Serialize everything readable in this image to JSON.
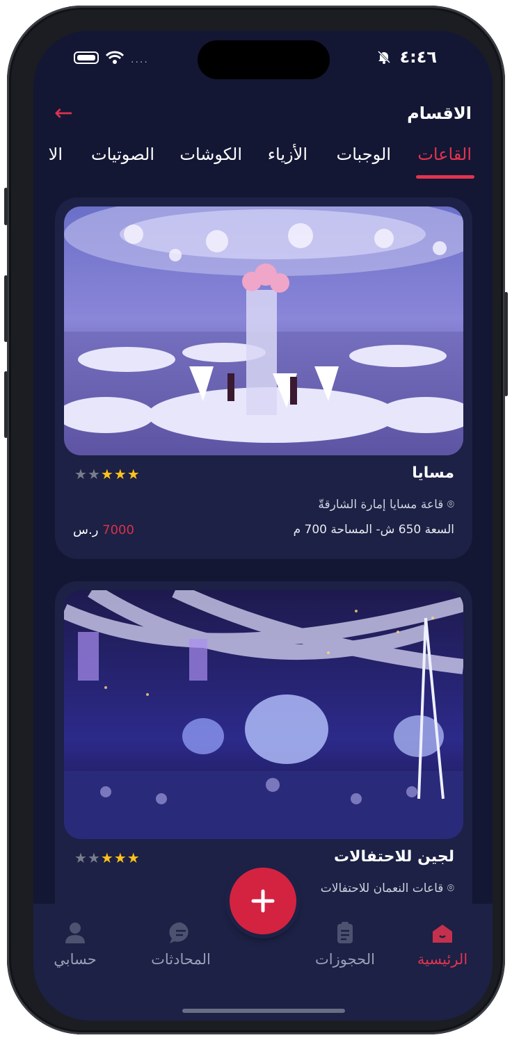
{
  "status": {
    "time": "٤:٤٦",
    "signal_dots": "....",
    "icons": [
      "battery-icon",
      "wifi-icon",
      "bell-off-icon"
    ]
  },
  "header": {
    "title": "الاقسام",
    "back_icon": "back-arrow-icon"
  },
  "tabs": [
    {
      "label": "القاعات",
      "active": true
    },
    {
      "label": "الوجبات",
      "active": false
    },
    {
      "label": "الأزياء",
      "active": false
    },
    {
      "label": "الكوشات",
      "active": false
    },
    {
      "label": "الصوتيات",
      "active": false
    },
    {
      "label": "الا",
      "active": false
    }
  ],
  "cards": [
    {
      "name": "مسايا",
      "location": "قاعة مسايا إمارة الشارقةّ",
      "info": "السعة 650 ش- المساحة 700 م",
      "price": "7000",
      "currency": "ر.س",
      "rating": 3,
      "max_rating": 5,
      "image": "banquet-hall-photo"
    },
    {
      "name": "لجين للاحتفالات",
      "location": "قاعات النعمان للاحتفالات",
      "rating": 3,
      "max_rating": 5,
      "image": "event-venue-photo"
    }
  ],
  "bottom_nav": {
    "items": [
      {
        "label": "الرئيسية",
        "icon": "home-icon",
        "active": true
      },
      {
        "label": "الحجوزات",
        "icon": "clipboard-icon",
        "active": false
      },
      {
        "label": "المحادثات",
        "icon": "chat-icon",
        "active": false
      },
      {
        "label": "حسابي",
        "icon": "user-icon",
        "active": false
      }
    ],
    "fab_icon": "plus-icon"
  },
  "colors": {
    "background": "#131734",
    "card": "#1c2145",
    "accent": "#e3344f",
    "star": "#ffc21a"
  }
}
